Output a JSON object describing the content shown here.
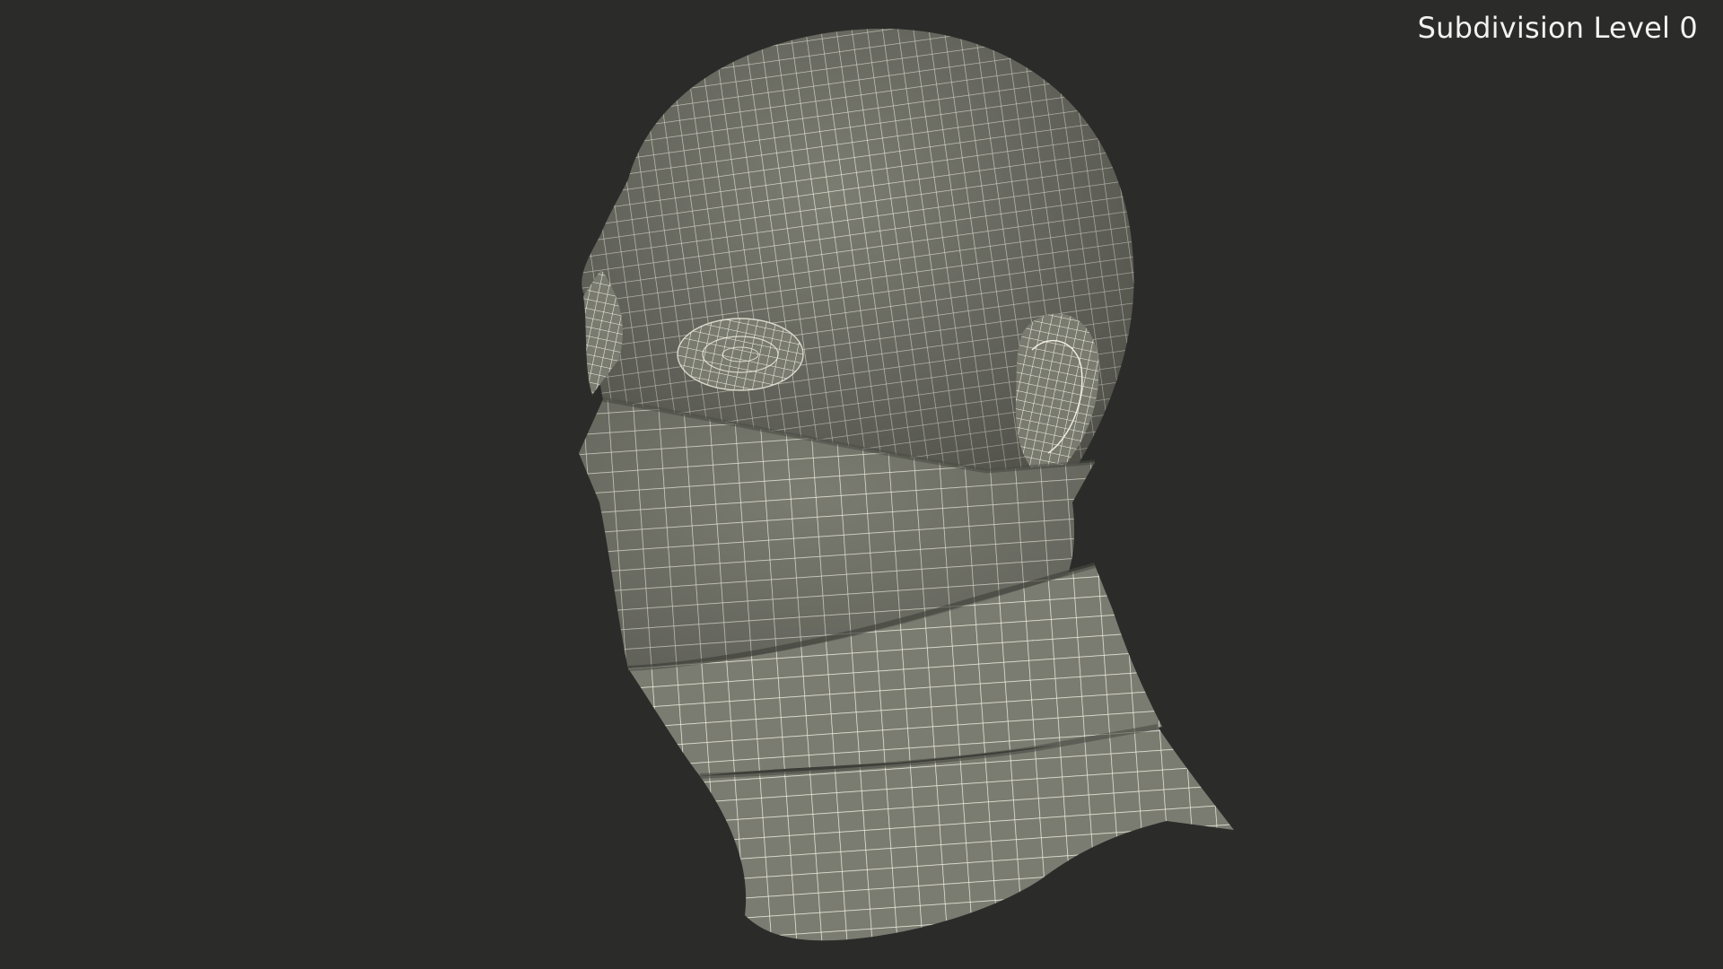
{
  "viewport": {
    "background_color": "#2b2c2a",
    "mesh_fill_color": "#7c7d72",
    "wire_color": "#f3f1e4"
  },
  "overlay": {
    "subdivision_label": "Subdivision Level 0"
  },
  "model": {
    "icon": "wireframe-head-with-face-mask"
  }
}
